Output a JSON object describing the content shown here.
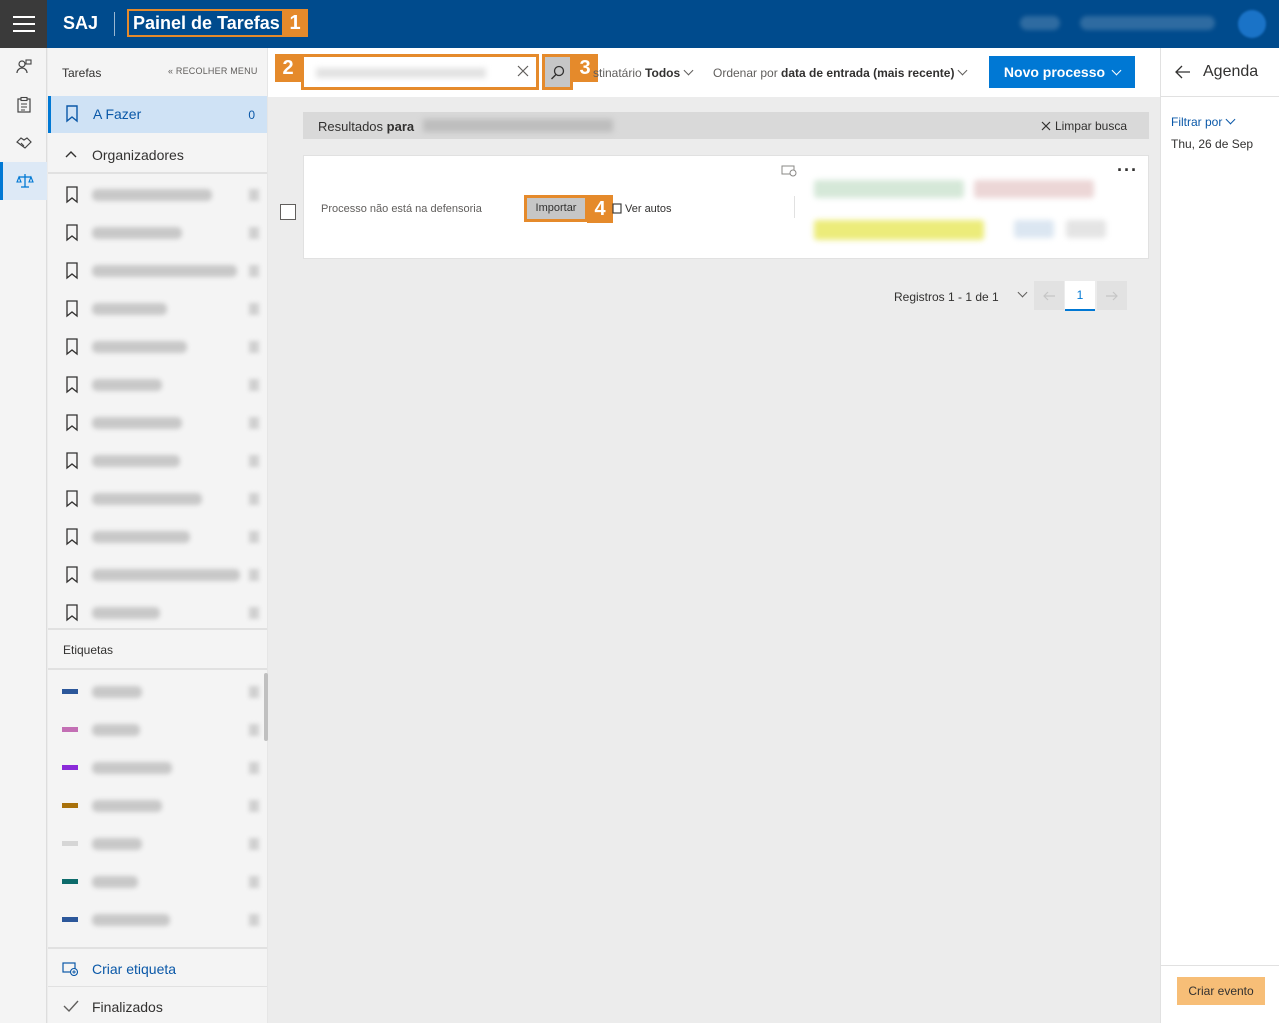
{
  "header": {
    "brand": "SAJ",
    "page_title": "Painel de Tarefas",
    "callout_1": "1"
  },
  "rail": {
    "icons": [
      "users-icon",
      "clipboard-icon",
      "handshake-icon",
      "scales-icon"
    ]
  },
  "sidebar": {
    "heading": "Tarefas",
    "collapse_label": "RECOLHER MENU",
    "afazer_label": "A Fazer",
    "afazer_count": "0",
    "organizadores_label": "Organizadores",
    "etiquetas_label": "Etiquetas",
    "etiqueta_colors": [
      "#2b579a",
      "#c36fb4",
      "#8b2bd9",
      "#a8710b",
      "#d6d6d6",
      "#0d6b6b",
      "#2b579a"
    ],
    "criar_etiqueta_label": "Criar etiqueta",
    "finalizados_label": "Finalizados"
  },
  "toolbar": {
    "callout_2": "2",
    "callout_3": "3",
    "destinatario_label": "stinatário",
    "destinatario_value": "Todos",
    "ordenar_label": "Ordenar por",
    "ordenar_value": "data de entrada (mais recente)",
    "novo_processo_label": "Novo processo"
  },
  "results": {
    "label": "Resultados",
    "para": "para",
    "clear_label": "Limpar busca"
  },
  "card": {
    "status_text": "Processo não está na defensoria",
    "importar_label": "Importar",
    "callout_4": "4",
    "ver_autos_label": "Ver autos"
  },
  "pager": {
    "label": "Registros 1 - 1 de 1",
    "current_page": "1"
  },
  "agenda": {
    "title": "Agenda",
    "filtrar_label": "Filtrar por",
    "date_label": "Thu, 26 de Sep",
    "criar_evento_label": "Criar evento"
  },
  "colors": {
    "header_bg": "#004b8d",
    "accent": "#0078d4",
    "callout": "#e58a2b",
    "criar_evento_bg": "#f7be77"
  }
}
